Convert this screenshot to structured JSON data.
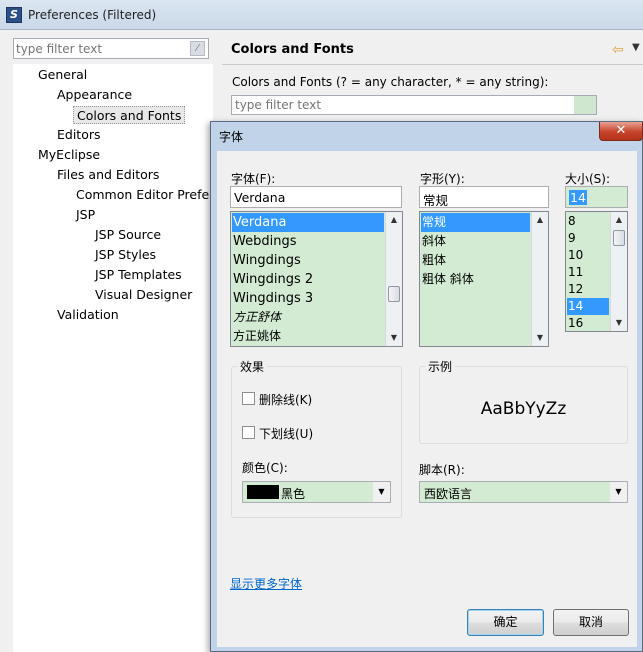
{
  "prefs": {
    "title": "Preferences (Filtered)",
    "filter_placeholder": "type filter text",
    "tree": [
      {
        "label": "General"
      },
      {
        "label": "Appearance"
      },
      {
        "label": "Colors and Fonts"
      },
      {
        "label": "Editors"
      },
      {
        "label": "MyEclipse"
      },
      {
        "label": "Files and Editors"
      },
      {
        "label": "Common Editor Prefer"
      },
      {
        "label": "JSP"
      },
      {
        "label": "JSP Source"
      },
      {
        "label": "JSP Styles"
      },
      {
        "label": "JSP Templates"
      },
      {
        "label": "Visual Designer"
      },
      {
        "label": "Validation"
      }
    ],
    "page_heading": "Colors and Fonts",
    "filter_description": "Colors and Fonts (? = any character, * = any string):",
    "page_filter_placeholder": "type filter text"
  },
  "font_dialog": {
    "title": "字体",
    "font_label": "字体(F):",
    "font_value": "Verdana",
    "font_list": [
      "Verdana",
      "Webdings",
      "Wingdings",
      "Wingdings 2",
      "Wingdings 3",
      "方正舒体",
      "方正姚体"
    ],
    "style_label": "字形(Y):",
    "style_value": "常规",
    "style_list": [
      "常规",
      "斜体",
      "粗体",
      "粗体 斜体"
    ],
    "size_label": "大小(S):",
    "size_value": "14",
    "size_list": [
      "8",
      "9",
      "10",
      "11",
      "12",
      "14",
      "16"
    ],
    "effects_label": "效果",
    "strikeout_label": "删除线(K)",
    "underline_label": "下划线(U)",
    "color_label": "颜色(C):",
    "color_value": "黑色",
    "color_swatch": "#000000",
    "sample_label": "示例",
    "sample_text": "AaBbYyZz",
    "script_label": "脚本(R):",
    "script_value": "西欧语言",
    "more_fonts_link": "显示更多字体",
    "ok_label": "确定",
    "cancel_label": "取消"
  },
  "colors": {
    "list_background": "#d3ead3",
    "selection": "#3399ff",
    "link": "#0066cc"
  }
}
